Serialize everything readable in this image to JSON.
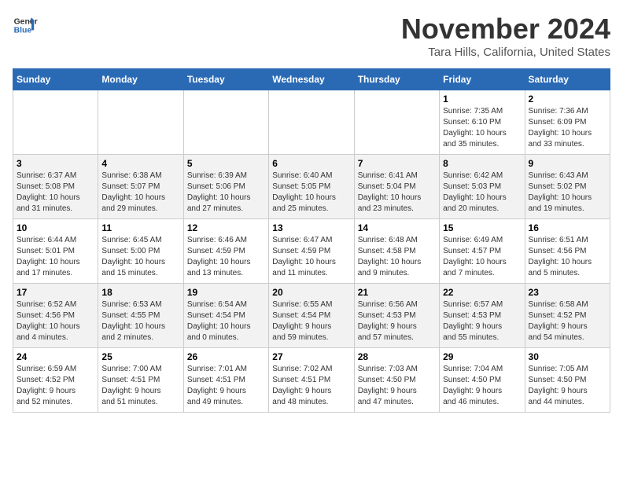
{
  "header": {
    "logo_line1": "General",
    "logo_line2": "Blue",
    "month_title": "November 2024",
    "location": "Tara Hills, California, United States"
  },
  "weekdays": [
    "Sunday",
    "Monday",
    "Tuesday",
    "Wednesday",
    "Thursday",
    "Friday",
    "Saturday"
  ],
  "weeks": [
    [
      {
        "day": "",
        "info": ""
      },
      {
        "day": "",
        "info": ""
      },
      {
        "day": "",
        "info": ""
      },
      {
        "day": "",
        "info": ""
      },
      {
        "day": "",
        "info": ""
      },
      {
        "day": "1",
        "info": "Sunrise: 7:35 AM\nSunset: 6:10 PM\nDaylight: 10 hours\nand 35 minutes."
      },
      {
        "day": "2",
        "info": "Sunrise: 7:36 AM\nSunset: 6:09 PM\nDaylight: 10 hours\nand 33 minutes."
      }
    ],
    [
      {
        "day": "3",
        "info": "Sunrise: 6:37 AM\nSunset: 5:08 PM\nDaylight: 10 hours\nand 31 minutes."
      },
      {
        "day": "4",
        "info": "Sunrise: 6:38 AM\nSunset: 5:07 PM\nDaylight: 10 hours\nand 29 minutes."
      },
      {
        "day": "5",
        "info": "Sunrise: 6:39 AM\nSunset: 5:06 PM\nDaylight: 10 hours\nand 27 minutes."
      },
      {
        "day": "6",
        "info": "Sunrise: 6:40 AM\nSunset: 5:05 PM\nDaylight: 10 hours\nand 25 minutes."
      },
      {
        "day": "7",
        "info": "Sunrise: 6:41 AM\nSunset: 5:04 PM\nDaylight: 10 hours\nand 23 minutes."
      },
      {
        "day": "8",
        "info": "Sunrise: 6:42 AM\nSunset: 5:03 PM\nDaylight: 10 hours\nand 20 minutes."
      },
      {
        "day": "9",
        "info": "Sunrise: 6:43 AM\nSunset: 5:02 PM\nDaylight: 10 hours\nand 19 minutes."
      }
    ],
    [
      {
        "day": "10",
        "info": "Sunrise: 6:44 AM\nSunset: 5:01 PM\nDaylight: 10 hours\nand 17 minutes."
      },
      {
        "day": "11",
        "info": "Sunrise: 6:45 AM\nSunset: 5:00 PM\nDaylight: 10 hours\nand 15 minutes."
      },
      {
        "day": "12",
        "info": "Sunrise: 6:46 AM\nSunset: 4:59 PM\nDaylight: 10 hours\nand 13 minutes."
      },
      {
        "day": "13",
        "info": "Sunrise: 6:47 AM\nSunset: 4:59 PM\nDaylight: 10 hours\nand 11 minutes."
      },
      {
        "day": "14",
        "info": "Sunrise: 6:48 AM\nSunset: 4:58 PM\nDaylight: 10 hours\nand 9 minutes."
      },
      {
        "day": "15",
        "info": "Sunrise: 6:49 AM\nSunset: 4:57 PM\nDaylight: 10 hours\nand 7 minutes."
      },
      {
        "day": "16",
        "info": "Sunrise: 6:51 AM\nSunset: 4:56 PM\nDaylight: 10 hours\nand 5 minutes."
      }
    ],
    [
      {
        "day": "17",
        "info": "Sunrise: 6:52 AM\nSunset: 4:56 PM\nDaylight: 10 hours\nand 4 minutes."
      },
      {
        "day": "18",
        "info": "Sunrise: 6:53 AM\nSunset: 4:55 PM\nDaylight: 10 hours\nand 2 minutes."
      },
      {
        "day": "19",
        "info": "Sunrise: 6:54 AM\nSunset: 4:54 PM\nDaylight: 10 hours\nand 0 minutes."
      },
      {
        "day": "20",
        "info": "Sunrise: 6:55 AM\nSunset: 4:54 PM\nDaylight: 9 hours\nand 59 minutes."
      },
      {
        "day": "21",
        "info": "Sunrise: 6:56 AM\nSunset: 4:53 PM\nDaylight: 9 hours\nand 57 minutes."
      },
      {
        "day": "22",
        "info": "Sunrise: 6:57 AM\nSunset: 4:53 PM\nDaylight: 9 hours\nand 55 minutes."
      },
      {
        "day": "23",
        "info": "Sunrise: 6:58 AM\nSunset: 4:52 PM\nDaylight: 9 hours\nand 54 minutes."
      }
    ],
    [
      {
        "day": "24",
        "info": "Sunrise: 6:59 AM\nSunset: 4:52 PM\nDaylight: 9 hours\nand 52 minutes."
      },
      {
        "day": "25",
        "info": "Sunrise: 7:00 AM\nSunset: 4:51 PM\nDaylight: 9 hours\nand 51 minutes."
      },
      {
        "day": "26",
        "info": "Sunrise: 7:01 AM\nSunset: 4:51 PM\nDaylight: 9 hours\nand 49 minutes."
      },
      {
        "day": "27",
        "info": "Sunrise: 7:02 AM\nSunset: 4:51 PM\nDaylight: 9 hours\nand 48 minutes."
      },
      {
        "day": "28",
        "info": "Sunrise: 7:03 AM\nSunset: 4:50 PM\nDaylight: 9 hours\nand 47 minutes."
      },
      {
        "day": "29",
        "info": "Sunrise: 7:04 AM\nSunset: 4:50 PM\nDaylight: 9 hours\nand 46 minutes."
      },
      {
        "day": "30",
        "info": "Sunrise: 7:05 AM\nSunset: 4:50 PM\nDaylight: 9 hours\nand 44 minutes."
      }
    ]
  ]
}
